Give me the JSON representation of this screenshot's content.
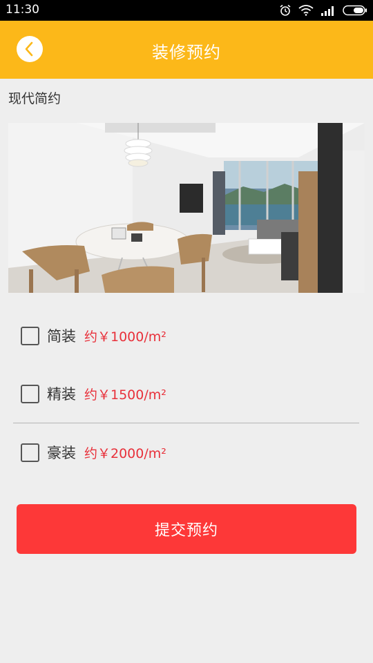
{
  "status_bar": {
    "time": "11:30",
    "icons": [
      "alarm-icon",
      "wifi-icon",
      "signal-icon",
      "battery-icon"
    ]
  },
  "header": {
    "title": "装修预约",
    "back_icon": "chevron-left-icon",
    "background": "#fcb819"
  },
  "style_name": "现代简约",
  "photo": {
    "alt": "living-dining-room-photo"
  },
  "options": [
    {
      "label": "简装",
      "price": "约￥1000/m²",
      "checked": false
    },
    {
      "label": "精装",
      "price": "约￥1500/m²",
      "checked": false
    },
    {
      "label": "豪装",
      "price": "约￥2000/m²",
      "checked": false
    }
  ],
  "submit": {
    "label": "提交预约",
    "color": "#fd3838"
  },
  "colors": {
    "price": "#e8303a",
    "page_bg": "#eeeeee"
  }
}
